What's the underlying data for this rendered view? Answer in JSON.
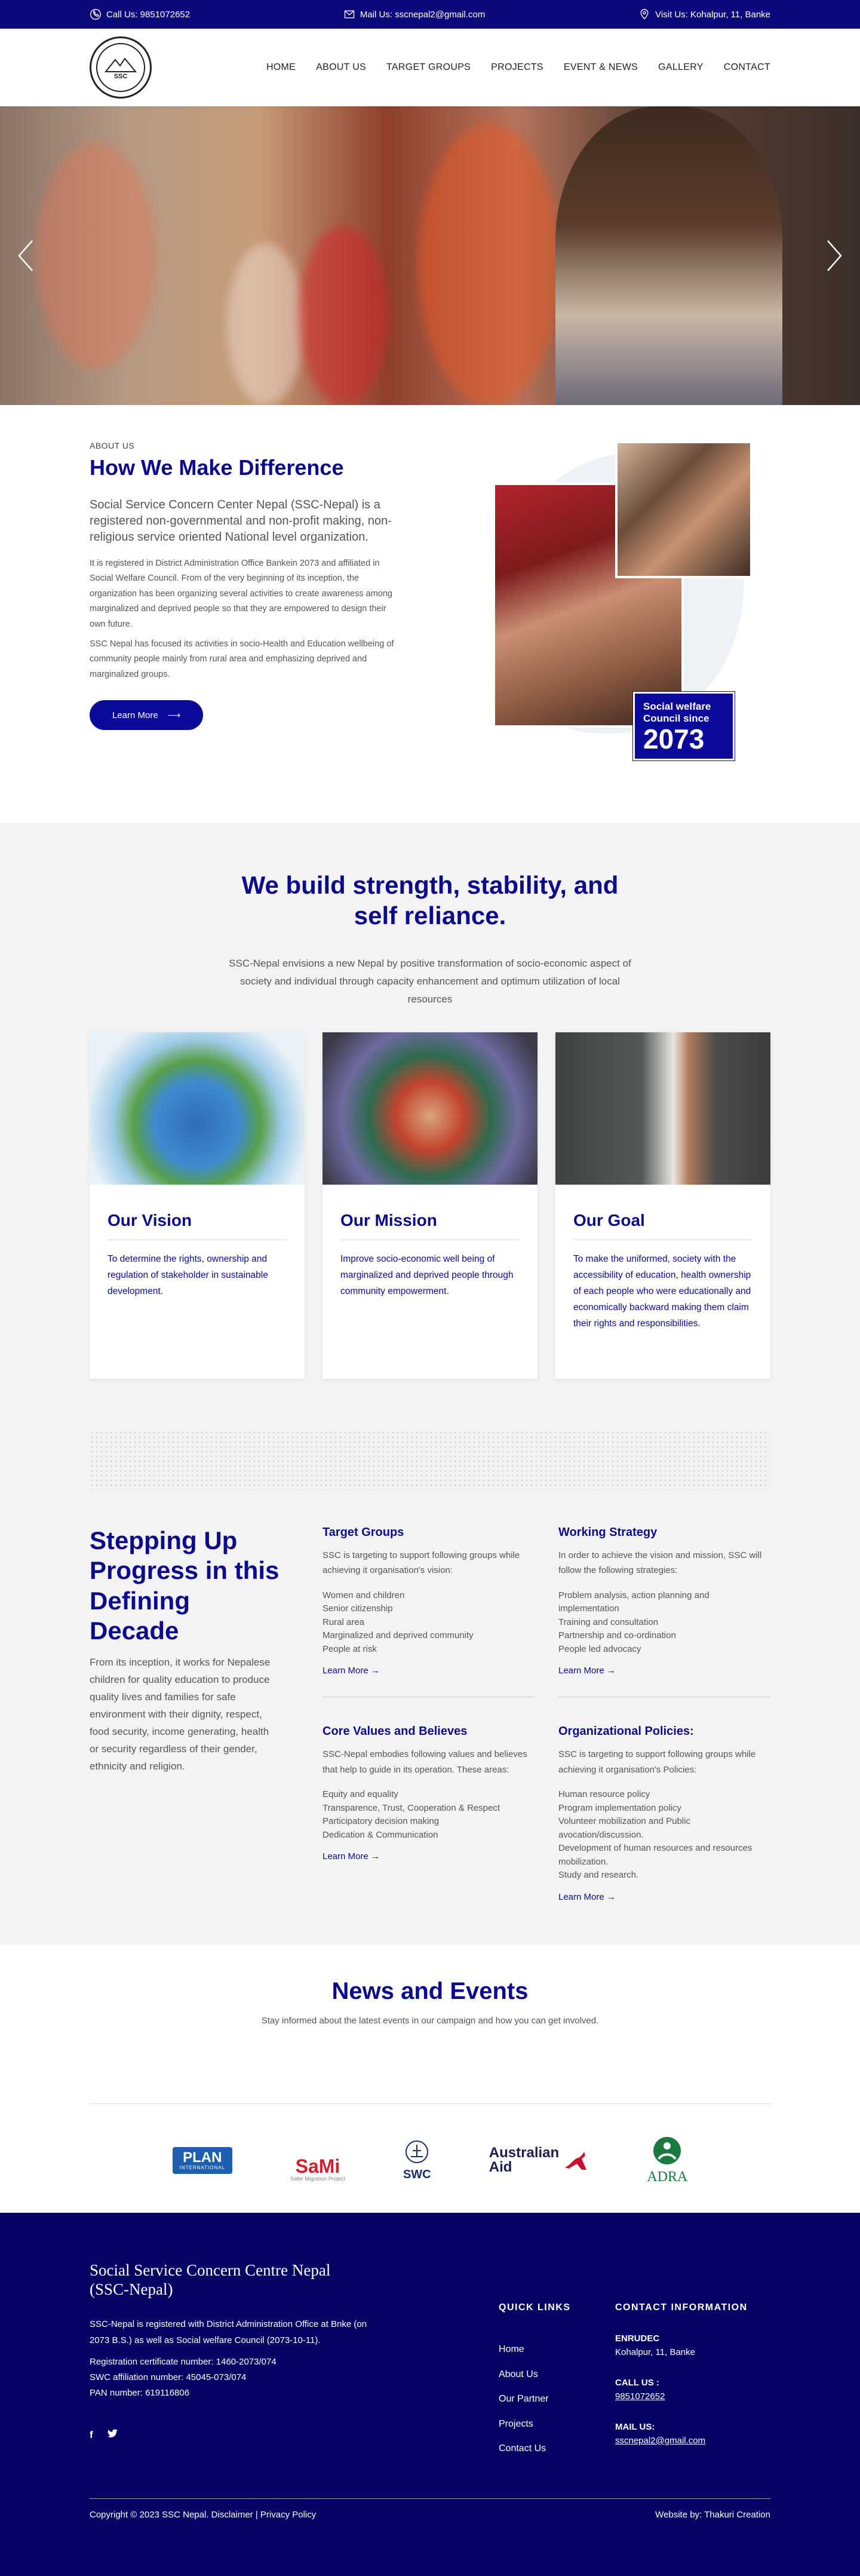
{
  "topbar": {
    "phone": "Call Us: 9851072652",
    "email": "Mail Us: sscnepal2@gmail.com",
    "address": "Visit Us: Kohalpur, 11, Banke"
  },
  "logo": {
    "text": "SSC"
  },
  "nav": [
    "HOME",
    "ABOUT US",
    "TARGET GROUPS",
    "PROJECTS",
    "EVENT & NEWS",
    "GALLERY",
    "CONTACT"
  ],
  "about": {
    "kicker": "ABOUT US",
    "title": "How We Make Difference",
    "lead": "Social Service Concern Center Nepal (SSC-Nepal) is a registered non-governmental and non-profit making, non-religious service oriented National level organization.",
    "p1": "It is registered in District Administration Office Bankein 2073 and affiliated in Social Welfare Council. From of the very beginning of its inception, the organization has been organizing several activities to create awareness among marginalized and deprived people so that they are empowered to design their own future.",
    "p2": "SSC Nepal has focused its activities in socio-Health and Education wellbeing of community people mainly from rural area and emphasizing deprived and marginalized groups.",
    "button": "Learn More",
    "badge_line": "Social welfare Council since",
    "badge_year": "2073"
  },
  "vision": {
    "title": "We build strength, stability, and self reliance.",
    "subtitle": "SSC-Nepal envisions a new Nepal by positive transformation of socio-economic aspect of society and individual through capacity enhancement and optimum utilization of local resources",
    "cards": [
      {
        "title": "Our Vision",
        "text": "To determine the rights, ownership and regulation of stakeholder in sustainable development."
      },
      {
        "title": "Our Mission",
        "text": "Improve socio-economic well being of marginalized and deprived people through community empowerment."
      },
      {
        "title": "Our Goal",
        "text": "To make the uniformed, society with the accessibility of education, health ownership of each people who were educationally and economically backward making them claim their rights and responsibilities."
      }
    ]
  },
  "step": {
    "title": "Stepping Up Progress in this Defining Decade",
    "text": "From its inception, it works for Nepalese children for quality education to produce quality lives and families for safe environment with their dignity, respect, food security, income generating, health or security regardless of their gender, ethnicity and religion.",
    "blocks": [
      {
        "title": "Target Groups",
        "desc": "SSC is targeting to support following groups while achieving it organisation's vision:",
        "items": [
          "Women and children",
          "Senior citizenship",
          "Rural area",
          "Marginalized and deprived community",
          "People at risk"
        ],
        "link": "Learn More"
      },
      {
        "title": "Working Strategy",
        "desc": "In order to achieve the vision and mission, SSC will follow the following strategies:",
        "items": [
          "Problem analysis, action planning and implementation",
          "Training and consultation",
          "Partnership and co-ordination",
          "People led advocacy"
        ],
        "link": "Learn More"
      },
      {
        "title": "Core Values and Believes",
        "desc": "SSC-Nepal embodies following values and believes that help to guide in its operation. These areas:",
        "items": [
          "Equity and equality",
          "Transparence, Trust, Cooperation & Respect",
          "Participatory decision making",
          "Dedication & Communication"
        ],
        "link": "Learn More"
      },
      {
        "title": "Organizational Policies:",
        "desc": "SSC is targeting to support following groups while achieving it organisation's Policies:",
        "items": [
          "Human resource policy",
          "Program implementation policy",
          "Volunteer mobilization and Public avocation/discussion.",
          "Development of human resources and resources mobilization.",
          "Study and research."
        ],
        "link": "Learn More"
      }
    ]
  },
  "news": {
    "title": "News and Events",
    "subtitle": "Stay informed about the latest events in our campaign and how you can get involved."
  },
  "partners": {
    "plan": "PLAN",
    "plan_sub": "INTERNATIONAL",
    "sami": "SaMi",
    "sami_sub": "Safer Migration Project",
    "swc": "SWC",
    "aa1": "Australian",
    "aa2": "Aid",
    "adra": "ADRA"
  },
  "footer": {
    "title": "Social Service Concern Centre Nepal (SSC-Nepal)",
    "desc": "SSC-Nepal is registered with District Administration Office at Bnke (on 2073 B.S.) as well as Social welfare Council (2073-10-11).",
    "reg1": "Registration certificate number: 1460-2073/074",
    "reg2": "SWC affiliation number: 45045-073/074",
    "reg3": "PAN number: 619116806",
    "quick_title": "QUICK LINKS",
    "links": [
      "Home",
      "About Us",
      "Our Partner",
      "Projects",
      "Contact Us"
    ],
    "contact_title": "CONTACT INFORMATION",
    "org_label": "ENRUDEC",
    "org_addr": "Kohalpur, 11, Banke",
    "call_label": "CALL US :",
    "call_val": "9851072652",
    "mail_label": "MAIL US:",
    "mail_val": "sscnepal2@gmail.com",
    "copyright": "Copyright © 2023 SSC Nepal. Disclaimer | Privacy Policy",
    "credit": "Website by: Thakuri Creation"
  },
  "colors": {
    "primary": "#0b0a7c",
    "heading": "#0c0a8e",
    "footer": "#050363"
  }
}
